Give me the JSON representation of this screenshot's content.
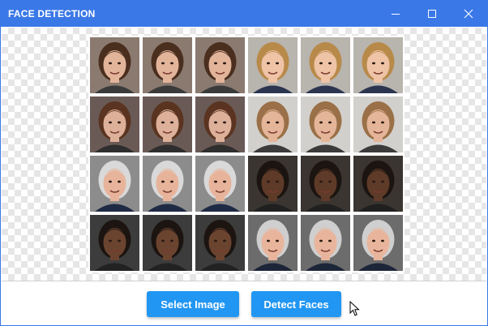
{
  "window": {
    "title": "FACE DETECTION"
  },
  "controls": {
    "minimize_icon": "minimize-icon",
    "maximize_icon": "maximize-icon",
    "close_icon": "close-icon"
  },
  "buttons": {
    "select_image": "Select Image",
    "detect_faces": "Detect Faces"
  },
  "colors": {
    "titlebar": "#3b78e7",
    "button": "#2196f3"
  },
  "image": {
    "grid": {
      "rows": 4,
      "columns": 6
    }
  }
}
